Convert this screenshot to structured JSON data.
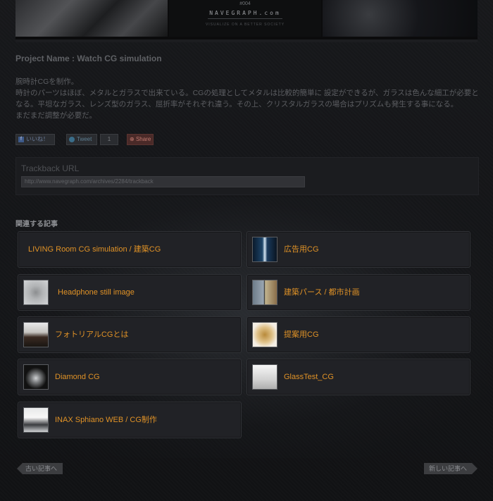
{
  "banner": {
    "number": "#004",
    "logo_text": "NAVEGRAPH.com",
    "subtitle": "VISUALIZE ON A BETTER SOCIETY"
  },
  "project": {
    "title": "Project Name : Watch CG simulation",
    "description": [
      "腕時計CGを制作。",
      "時計のパーツはほぼ、メタルとガラスで出来ている。CGの処理としてメタルは比較的簡単に 設定ができるが、ガラスは色んな細工が必要となる。平坦なガラス、レンズ型のガラス、屈折率がそれぞれ違う。その上、クリスタルガラスの場合はプリズムも発生する事になる。",
      "まだまだ調整が必要だ。"
    ]
  },
  "social": {
    "facebook_label": "いいね！",
    "tweet_label": "Tweet",
    "tweet_count": "1",
    "share_label": "Share"
  },
  "trackback": {
    "title": "Trackback URL",
    "url": "http://www.navegraph.com/archives/2284/trackback"
  },
  "related": {
    "title": "関連する記事",
    "items": [
      {
        "label": "LIVING Room CG simulation / 建築CG",
        "thumb": "none"
      },
      {
        "label": "広告用CG",
        "thumb": "ad-thumbnail"
      },
      {
        "label": "Headphone still image",
        "thumb": "headphone-thumbnail"
      },
      {
        "label": "建築パース / 都市計画",
        "thumb": "architecture-thumbnail"
      },
      {
        "label": "フォトリアルCGとは",
        "thumb": "photoreal-thumbnail"
      },
      {
        "label": "提案用CG",
        "thumb": "proposal-thumbnail"
      },
      {
        "label": "Diamond CG",
        "thumb": "diamond-thumbnail"
      },
      {
        "label": "GlassTest_CG",
        "thumb": "glass-thumbnail"
      },
      {
        "label": "INAX Sphiano WEB / CG制作",
        "thumb": "inax-thumbnail"
      }
    ]
  },
  "pagination": {
    "prev_label": "古い記事へ",
    "next_label": "新しい記事へ"
  },
  "colors": {
    "link_orange": "#e09226",
    "background": "#131416",
    "card_bg": "#212226"
  }
}
